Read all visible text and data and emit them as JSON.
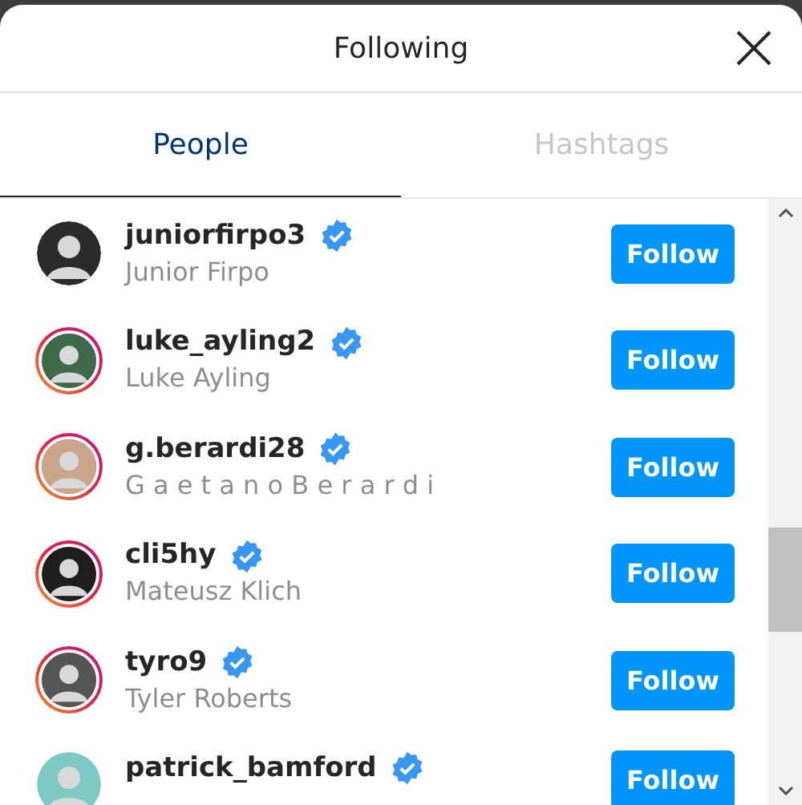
{
  "dialog": {
    "title": "Following"
  },
  "tabs": [
    {
      "label": "People",
      "selected": true
    },
    {
      "label": "Hashtags",
      "selected": false
    }
  ],
  "accounts": [
    {
      "username": "juniorfirpo3",
      "full_name": "Junior Firpo",
      "verified": true,
      "story": false,
      "button": "Follow"
    },
    {
      "username": "luke_ayling2",
      "full_name": "Luke Ayling",
      "verified": true,
      "story": true,
      "button": "Follow"
    },
    {
      "username": "g.berardi28",
      "full_name": "G a e t a n o B e r a r d i",
      "verified": true,
      "story": true,
      "button": "Follow"
    },
    {
      "username": "cli5hy",
      "full_name": "Mateusz Klich",
      "verified": true,
      "story": true,
      "button": "Follow"
    },
    {
      "username": "tyro9",
      "full_name": "Tyler Roberts",
      "verified": true,
      "story": true,
      "button": "Follow"
    },
    {
      "username": "patrick_bamford",
      "verified": true,
      "story": false,
      "button": "Follow"
    }
  ]
}
